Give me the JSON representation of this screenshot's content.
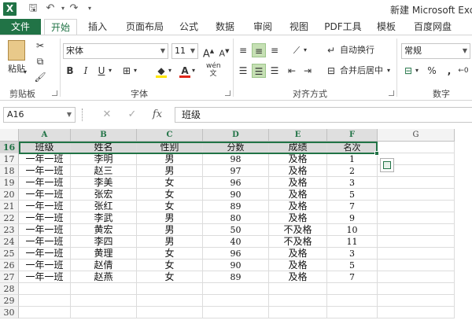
{
  "window": {
    "title": "新建 Microsoft Exce",
    "app_icon": "X"
  },
  "quick_access": {
    "save_icon": "save-icon",
    "undo_icon": "undo-icon",
    "redo_icon": "redo-icon",
    "customize_icon": "dropdown-icon"
  },
  "tabs": [
    "文件",
    "开始",
    "插入",
    "页面布局",
    "公式",
    "数据",
    "审阅",
    "视图",
    "PDF工具",
    "模板",
    "百度网盘"
  ],
  "ribbon": {
    "clipboard": {
      "paste_label": "粘贴",
      "group_label": "剪贴板"
    },
    "font": {
      "name": "宋体",
      "size": "11",
      "bold": "B",
      "italic": "I",
      "underline": "U",
      "group_label": "字体",
      "font_color": "#e0271a",
      "fill_color": "#ffe600",
      "phonetic": "wén"
    },
    "alignment": {
      "wrap_text": "自动换行",
      "merge_center": "合并后居中",
      "group_label": "对齐方式"
    },
    "number": {
      "format": "常规",
      "percent": "%",
      "comma": ",",
      "group_label": "数字"
    }
  },
  "formula_bar": {
    "name_box": "A16",
    "cancel": "✕",
    "enter": "✓",
    "fx": "fx",
    "content": "班级"
  },
  "grid": {
    "columns": [
      "A",
      "B",
      "C",
      "D",
      "E",
      "F",
      "G"
    ],
    "rows": [
      {
        "num": "16",
        "cells": [
          "班级",
          "姓名",
          "性别",
          "分数",
          "成绩",
          "名次"
        ]
      },
      {
        "num": "17",
        "cells": [
          "一年一班",
          "李明",
          "男",
          "98",
          "及格",
          "1"
        ]
      },
      {
        "num": "18",
        "cells": [
          "一年一班",
          "赵三",
          "男",
          "97",
          "及格",
          "2"
        ]
      },
      {
        "num": "19",
        "cells": [
          "一年一班",
          "李美",
          "女",
          "96",
          "及格",
          "3"
        ]
      },
      {
        "num": "20",
        "cells": [
          "一年一班",
          "张宏",
          "女",
          "90",
          "及格",
          "5"
        ]
      },
      {
        "num": "21",
        "cells": [
          "一年一班",
          "张红",
          "女",
          "89",
          "及格",
          "7"
        ]
      },
      {
        "num": "22",
        "cells": [
          "一年一班",
          "李武",
          "男",
          "80",
          "及格",
          "9"
        ]
      },
      {
        "num": "23",
        "cells": [
          "一年一班",
          "黄宏",
          "男",
          "50",
          "不及格",
          "10"
        ]
      },
      {
        "num": "24",
        "cells": [
          "一年一班",
          "李四",
          "男",
          "40",
          "不及格",
          "11"
        ]
      },
      {
        "num": "25",
        "cells": [
          "一年一班",
          "黄理",
          "女",
          "96",
          "及格",
          "3"
        ]
      },
      {
        "num": "26",
        "cells": [
          "一年一班",
          "赵倩",
          "女",
          "90",
          "及格",
          "5"
        ]
      },
      {
        "num": "27",
        "cells": [
          "一年一班",
          "赵燕",
          "女",
          "89",
          "及格",
          "7"
        ]
      },
      {
        "num": "28",
        "cells": [
          "",
          "",
          "",
          "",
          "",
          ""
        ]
      },
      {
        "num": "29",
        "cells": [
          "",
          "",
          "",
          "",
          "",
          ""
        ]
      },
      {
        "num": "30",
        "cells": [
          "",
          "",
          "",
          "",
          "",
          ""
        ]
      }
    ]
  },
  "colors": {
    "accent": "#217346",
    "header_fill": "#d9d9d9",
    "selection_border": "#217346"
  }
}
